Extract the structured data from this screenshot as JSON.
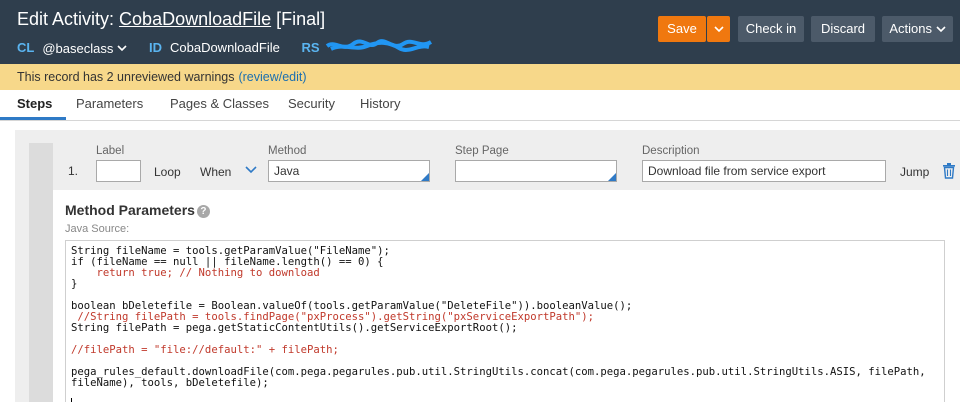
{
  "header": {
    "title_prefix": "Edit Activity: ",
    "rule_name": "CobaDownloadFile",
    "title_suffix": " [Final]",
    "class_key": "CL",
    "class_value": "@baseclass",
    "id_key": "ID",
    "id_value": "CobaDownloadFile",
    "ruleset_key": "RS"
  },
  "toolbar": {
    "save_label": "Save",
    "checkin_label": "Check in",
    "discard_label": "Discard",
    "actions_label": "Actions"
  },
  "warning": {
    "text": "This record has 2 unreviewed warnings",
    "link": "(review/edit)"
  },
  "tabs": [
    {
      "label": "Steps",
      "active": true
    },
    {
      "label": "Parameters"
    },
    {
      "label": "Pages & Classes"
    },
    {
      "label": "Security"
    },
    {
      "label": "History"
    }
  ],
  "step": {
    "number": "1.",
    "label_header": "Label",
    "label_value": "",
    "loop_label": "Loop",
    "when_label": "When",
    "method_header": "Method",
    "method_value": "Java",
    "steppage_header": "Step Page",
    "steppage_value": "",
    "description_header": "Description",
    "description_value": "Download file from service export",
    "jump_label": "Jump"
  },
  "method_parameters": {
    "title": "Method Parameters",
    "help": "?",
    "source_label": "Java Source:",
    "code_lines": [
      "String fileName = tools.getParamValue(\"FileName\");",
      "if (fileName == null || fileName.length() == 0) {",
      "    return true; // Nothing to download",
      "}",
      "",
      "boolean bDeletefile = Boolean.valueOf(tools.getParamValue(\"DeleteFile\")).booleanValue();",
      " //String filePath = tools.findPage(\"pxProcess\").getString(\"pxServiceExportPath\");",
      "String filePath = pega.getStaticContentUtils().getServiceExportRoot();",
      "",
      "//filePath = \"file://default:\" + filePath;",
      "",
      "pega_rules_default.downloadFile(com.pega.pegarules.pub.util.StringUtils.concat(com.pega.pegarules.pub.util.StringUtils.ASIS, filePath,",
      "fileName), tools, bDeletefile);"
    ]
  },
  "colors": {
    "header_bg": "#2f3e4d",
    "save_orange": "#f0780f",
    "warning_bg": "#f7d88a",
    "link_blue": "#1b6fb0",
    "accent_blue": "#2f7ac6"
  }
}
